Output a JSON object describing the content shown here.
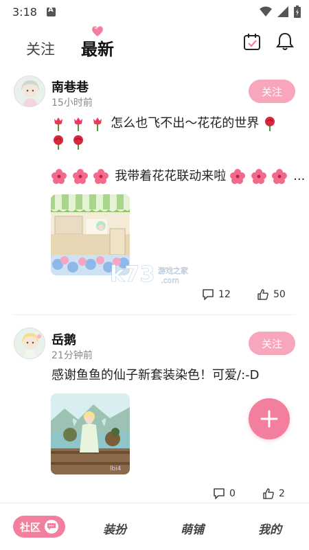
{
  "status_bar": {
    "time": "3:18"
  },
  "header": {
    "tab_follow": "关注",
    "tab_latest": "最新"
  },
  "posts": [
    {
      "username": "南巷巷",
      "time": "15小时前",
      "follow_label": "关注",
      "line1_text": "怎么也飞不出～花花的世界",
      "line3_text": "我带着花花联动来啦",
      "line3_suffix": "...",
      "comments": "12",
      "likes": "50"
    },
    {
      "username": "岳鹅",
      "time": "21分钟前",
      "follow_label": "关注",
      "text": "感谢鱼鱼的仙子新套装染色！可爱/:-D",
      "comments": "0",
      "likes": "2"
    }
  ],
  "watermark": {
    "brand": "k73",
    "cn": "游戏之家",
    "domain": ".com"
  },
  "bottom_nav": {
    "community": "社区",
    "dress_up": "装扮",
    "shop": "萌铺",
    "mine": "我的"
  },
  "colors": {
    "accent": "#f37f9e",
    "follow_button": "#f7a6bb"
  }
}
